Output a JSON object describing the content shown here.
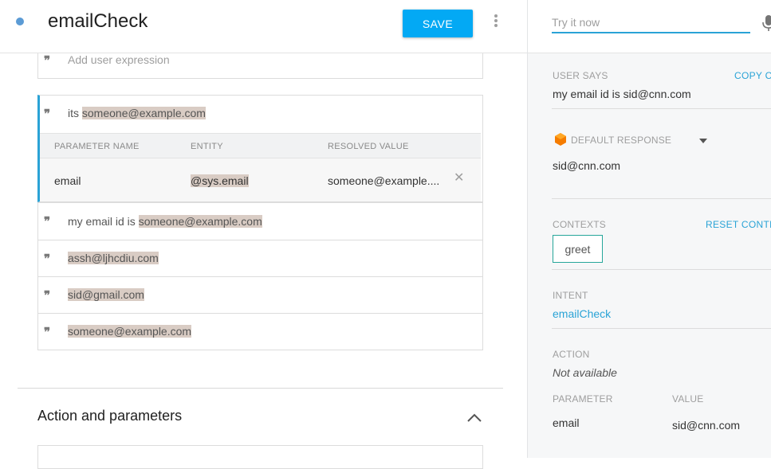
{
  "header": {
    "title": "emailCheck",
    "save_label": "SAVE"
  },
  "training": {
    "placeholder": "Add user expression",
    "active": {
      "prefix": "its ",
      "entity_text": "someone@example.com"
    },
    "param_table": {
      "headers": [
        "PARAMETER NAME",
        "ENTITY",
        "RESOLVED VALUE"
      ],
      "row": {
        "name": "email",
        "entity": "@sys.email",
        "value": "someone@example...."
      }
    },
    "phrases": [
      {
        "prefix": "my email id is ",
        "entity_text": "someone@example.com"
      },
      {
        "prefix": "",
        "entity_text": "assh@ljhcdiu.com"
      },
      {
        "prefix": "",
        "entity_text": "sid@gmail.com"
      },
      {
        "prefix": "",
        "entity_text": "someone@example.com"
      }
    ]
  },
  "action_section": {
    "title": "Action and parameters"
  },
  "console": {
    "input_placeholder": "Try it now",
    "user_says_label": "USER SAYS",
    "copy_label": "COPY CU",
    "user_says_text": "my email id is sid@cnn.com",
    "default_response_label": "DEFAULT RESPONSE",
    "response_text": "sid@cnn.com",
    "contexts_label": "CONTEXTS",
    "reset_label": "RESET CONTEX",
    "context_chip": "greet",
    "intent_label": "INTENT",
    "intent_value": "emailCheck",
    "action_label": "ACTION",
    "action_value": "Not available",
    "parameter_label": "PARAMETER",
    "value_label": "VALUE",
    "param_name": "email",
    "param_value": "sid@cnn.com"
  },
  "colors": {
    "accent": "#03a9f4",
    "link": "#2aa3d6",
    "highlight": "#d9ccc4",
    "context_border": "#26a69a",
    "response_icon": "#f57c00"
  }
}
